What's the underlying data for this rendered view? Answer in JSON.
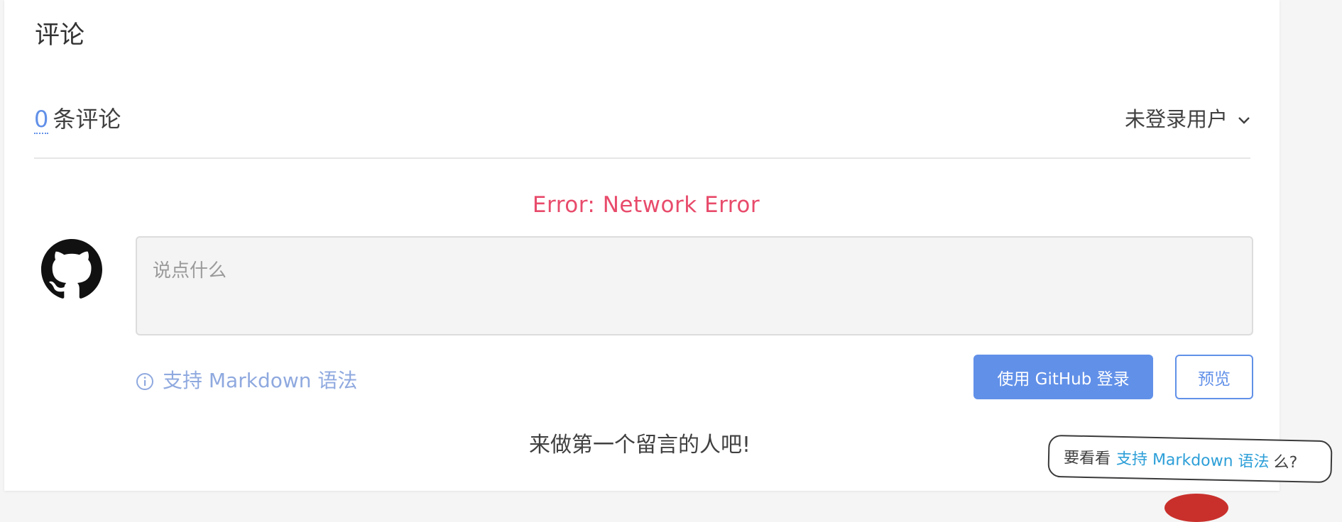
{
  "comments": {
    "section_title": "评论",
    "count": "0",
    "count_suffix": "条评论",
    "user_menu_label": "未登录用户",
    "error": "Error: Network Error",
    "placeholder": "说点什么",
    "markdown_hint": "支持 Markdown 语法",
    "login_button": "使用 GitHub 登录",
    "preview_button": "预览",
    "empty_message": "来做第一个留言的人吧!"
  },
  "tooltip": {
    "prefix": "要看看",
    "link": "支持 Markdown 语法",
    "suffix": "么?"
  },
  "icons": {
    "avatar": "github-icon",
    "user_menu_caret": "chevron-down-icon",
    "hint": "info-icon"
  },
  "colors": {
    "accent": "#6190e8",
    "error": "#e84b6b",
    "link": "#2d9fd8"
  }
}
